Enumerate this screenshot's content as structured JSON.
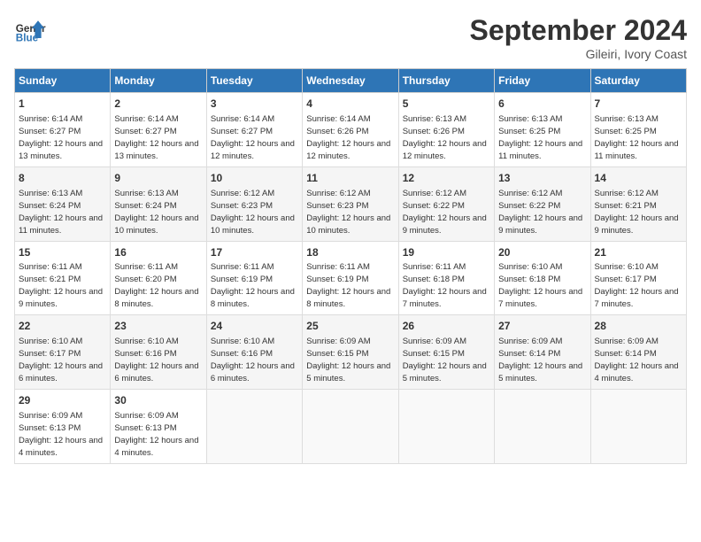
{
  "header": {
    "logo_line1": "General",
    "logo_line2": "Blue",
    "month_title": "September 2024",
    "location": "Gileiri, Ivory Coast"
  },
  "days_of_week": [
    "Sunday",
    "Monday",
    "Tuesday",
    "Wednesday",
    "Thursday",
    "Friday",
    "Saturday"
  ],
  "weeks": [
    [
      {
        "day": 1,
        "sunrise": "6:14 AM",
        "sunset": "6:27 PM",
        "daylight": "12 hours and 13 minutes."
      },
      {
        "day": 2,
        "sunrise": "6:14 AM",
        "sunset": "6:27 PM",
        "daylight": "12 hours and 13 minutes."
      },
      {
        "day": 3,
        "sunrise": "6:14 AM",
        "sunset": "6:27 PM",
        "daylight": "12 hours and 12 minutes."
      },
      {
        "day": 4,
        "sunrise": "6:14 AM",
        "sunset": "6:26 PM",
        "daylight": "12 hours and 12 minutes."
      },
      {
        "day": 5,
        "sunrise": "6:13 AM",
        "sunset": "6:26 PM",
        "daylight": "12 hours and 12 minutes."
      },
      {
        "day": 6,
        "sunrise": "6:13 AM",
        "sunset": "6:25 PM",
        "daylight": "12 hours and 11 minutes."
      },
      {
        "day": 7,
        "sunrise": "6:13 AM",
        "sunset": "6:25 PM",
        "daylight": "12 hours and 11 minutes."
      }
    ],
    [
      {
        "day": 8,
        "sunrise": "6:13 AM",
        "sunset": "6:24 PM",
        "daylight": "12 hours and 11 minutes."
      },
      {
        "day": 9,
        "sunrise": "6:13 AM",
        "sunset": "6:24 PM",
        "daylight": "12 hours and 10 minutes."
      },
      {
        "day": 10,
        "sunrise": "6:12 AM",
        "sunset": "6:23 PM",
        "daylight": "12 hours and 10 minutes."
      },
      {
        "day": 11,
        "sunrise": "6:12 AM",
        "sunset": "6:23 PM",
        "daylight": "12 hours and 10 minutes."
      },
      {
        "day": 12,
        "sunrise": "6:12 AM",
        "sunset": "6:22 PM",
        "daylight": "12 hours and 9 minutes."
      },
      {
        "day": 13,
        "sunrise": "6:12 AM",
        "sunset": "6:22 PM",
        "daylight": "12 hours and 9 minutes."
      },
      {
        "day": 14,
        "sunrise": "6:12 AM",
        "sunset": "6:21 PM",
        "daylight": "12 hours and 9 minutes."
      }
    ],
    [
      {
        "day": 15,
        "sunrise": "6:11 AM",
        "sunset": "6:21 PM",
        "daylight": "12 hours and 9 minutes."
      },
      {
        "day": 16,
        "sunrise": "6:11 AM",
        "sunset": "6:20 PM",
        "daylight": "12 hours and 8 minutes."
      },
      {
        "day": 17,
        "sunrise": "6:11 AM",
        "sunset": "6:19 PM",
        "daylight": "12 hours and 8 minutes."
      },
      {
        "day": 18,
        "sunrise": "6:11 AM",
        "sunset": "6:19 PM",
        "daylight": "12 hours and 8 minutes."
      },
      {
        "day": 19,
        "sunrise": "6:11 AM",
        "sunset": "6:18 PM",
        "daylight": "12 hours and 7 minutes."
      },
      {
        "day": 20,
        "sunrise": "6:10 AM",
        "sunset": "6:18 PM",
        "daylight": "12 hours and 7 minutes."
      },
      {
        "day": 21,
        "sunrise": "6:10 AM",
        "sunset": "6:17 PM",
        "daylight": "12 hours and 7 minutes."
      }
    ],
    [
      {
        "day": 22,
        "sunrise": "6:10 AM",
        "sunset": "6:17 PM",
        "daylight": "12 hours and 6 minutes."
      },
      {
        "day": 23,
        "sunrise": "6:10 AM",
        "sunset": "6:16 PM",
        "daylight": "12 hours and 6 minutes."
      },
      {
        "day": 24,
        "sunrise": "6:10 AM",
        "sunset": "6:16 PM",
        "daylight": "12 hours and 6 minutes."
      },
      {
        "day": 25,
        "sunrise": "6:09 AM",
        "sunset": "6:15 PM",
        "daylight": "12 hours and 5 minutes."
      },
      {
        "day": 26,
        "sunrise": "6:09 AM",
        "sunset": "6:15 PM",
        "daylight": "12 hours and 5 minutes."
      },
      {
        "day": 27,
        "sunrise": "6:09 AM",
        "sunset": "6:14 PM",
        "daylight": "12 hours and 5 minutes."
      },
      {
        "day": 28,
        "sunrise": "6:09 AM",
        "sunset": "6:14 PM",
        "daylight": "12 hours and 4 minutes."
      }
    ],
    [
      {
        "day": 29,
        "sunrise": "6:09 AM",
        "sunset": "6:13 PM",
        "daylight": "12 hours and 4 minutes."
      },
      {
        "day": 30,
        "sunrise": "6:09 AM",
        "sunset": "6:13 PM",
        "daylight": "12 hours and 4 minutes."
      },
      null,
      null,
      null,
      null,
      null
    ]
  ]
}
